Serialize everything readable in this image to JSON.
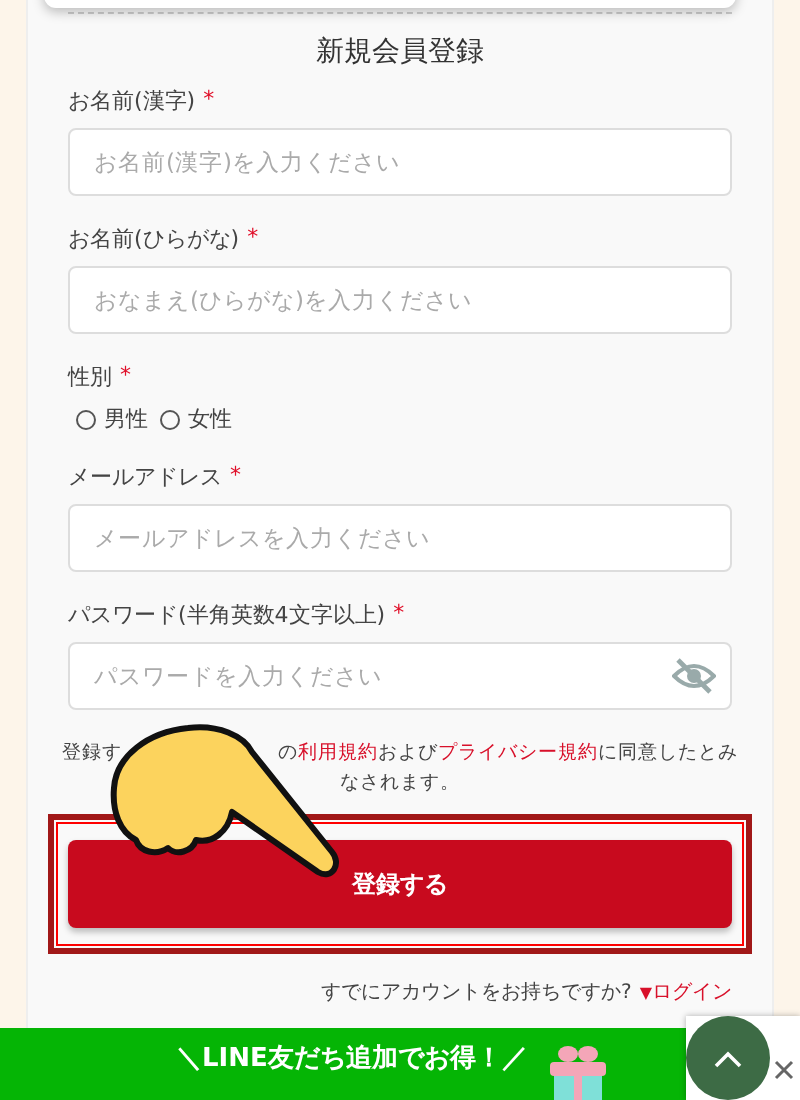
{
  "form": {
    "title": "新規会員登録",
    "fields": [
      {
        "kind": "text",
        "label": "お名前(漢字)",
        "required": true,
        "placeholder": "お名前(漢字)を入力ください"
      },
      {
        "kind": "text",
        "label": "お名前(ひらがな)",
        "required": true,
        "placeholder": "おなまえ(ひらがな)を入力ください"
      },
      {
        "kind": "radio",
        "label": "性別",
        "required": true,
        "options": [
          {
            "label": "男性",
            "selected": false
          },
          {
            "label": "女性",
            "selected": false
          }
        ]
      },
      {
        "kind": "text",
        "label": "メールアドレス",
        "required": true,
        "placeholder": "メールアドレスを入力ください"
      },
      {
        "kind": "password",
        "label": "パスワード(半角英数4文字以上)",
        "required": true,
        "placeholder": "パスワードを入力ください"
      }
    ],
    "required_mark": "*",
    "notice": {
      "lead": "登録す",
      "parts": [
        {
          "kind": "text",
          "text": "の"
        },
        {
          "kind": "link",
          "text": "利用規約"
        },
        {
          "kind": "text",
          "text": "および"
        },
        {
          "kind": "link",
          "text": "プライバシー規約"
        },
        {
          "kind": "text",
          "text": "に同意したとみなされます。"
        }
      ]
    },
    "submit": "登録する",
    "login_prompt": "すでにアカウントをお持ちですか?",
    "login_mark": "▼",
    "login_link": "ログイン"
  },
  "banner": {
    "text": "＼LINE友だち追加でお得！／"
  }
}
